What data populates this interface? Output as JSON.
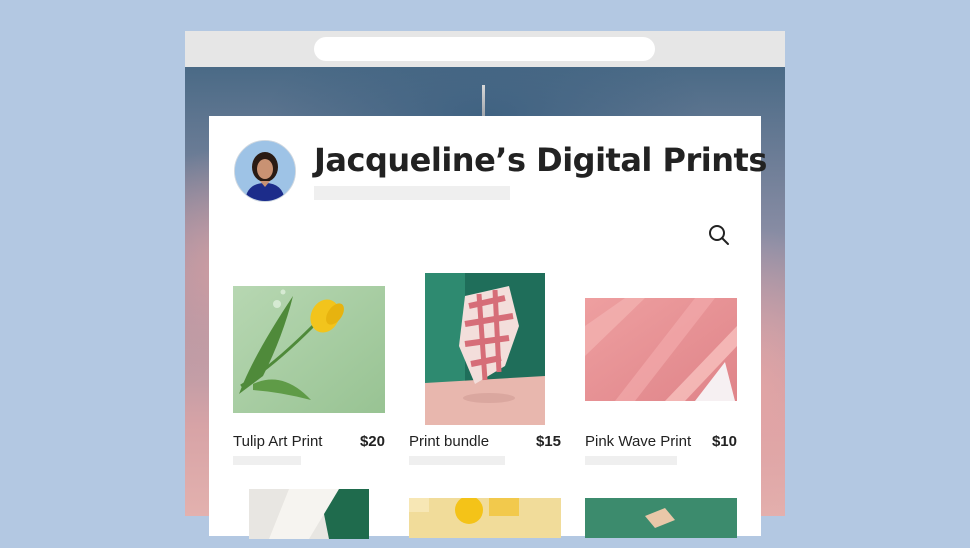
{
  "shop": {
    "title": "Jacqueline’s Digital Prints"
  },
  "products": [
    {
      "name": "Tulip Art Print",
      "price": "$20"
    },
    {
      "name": "Print bundle",
      "price": "$15"
    },
    {
      "name": "Pink Wave Print",
      "price": "$10"
    }
  ],
  "colors": {
    "page_background": "#b3c8e2",
    "card_background": "#ffffff",
    "placeholder_bar": "#efefef",
    "text": "#222222"
  },
  "icons": {
    "search": "search-icon"
  }
}
